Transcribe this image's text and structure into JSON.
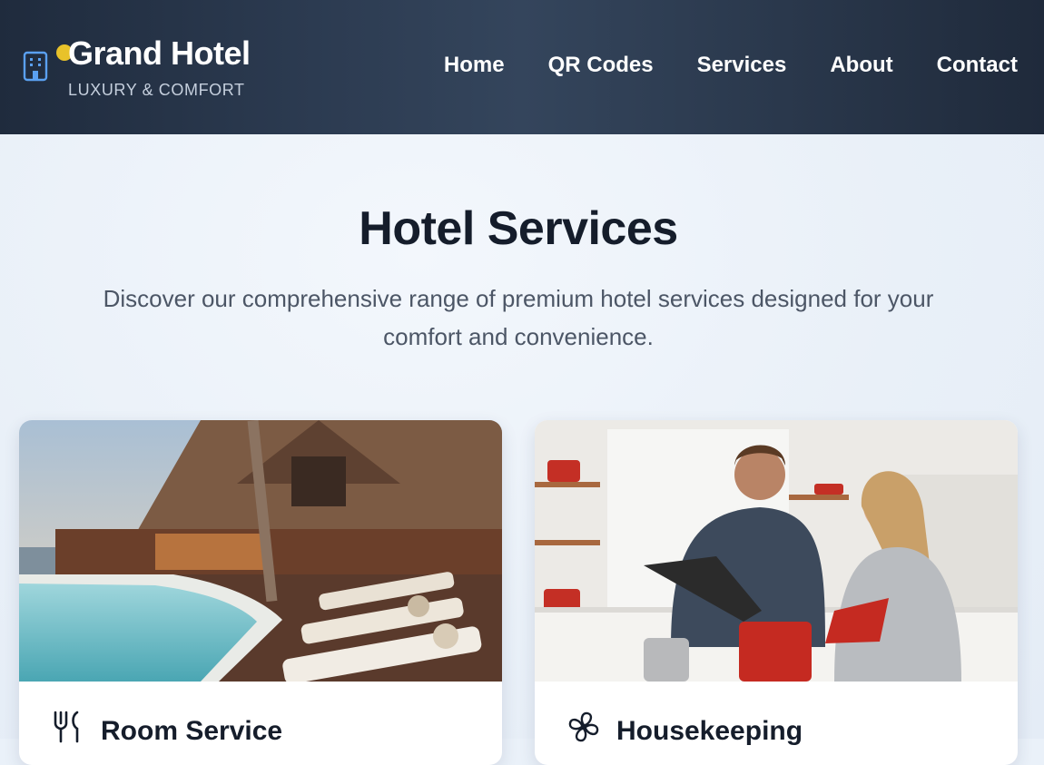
{
  "header": {
    "brand_title": "Grand Hotel",
    "brand_subtitle": "LUXURY & COMFORT",
    "nav": [
      {
        "label": "Home"
      },
      {
        "label": "QR Codes"
      },
      {
        "label": "Services"
      },
      {
        "label": "About"
      },
      {
        "label": "Contact"
      }
    ]
  },
  "main": {
    "title": "Hotel Services",
    "description": "Discover our comprehensive range of premium hotel services designed for your comfort and convenience."
  },
  "services": [
    {
      "title": "Room Service",
      "icon": "fork-knife-icon",
      "image": "resort-pool-photo"
    },
    {
      "title": "Housekeeping",
      "icon": "fan-icon",
      "image": "couple-cooking-photo"
    }
  ],
  "colors": {
    "header_bg": "#2c3b51",
    "accent_dot": "#e8c22a",
    "brand_icon": "#5aa0f0",
    "page_bg": "#eaf1f9"
  }
}
